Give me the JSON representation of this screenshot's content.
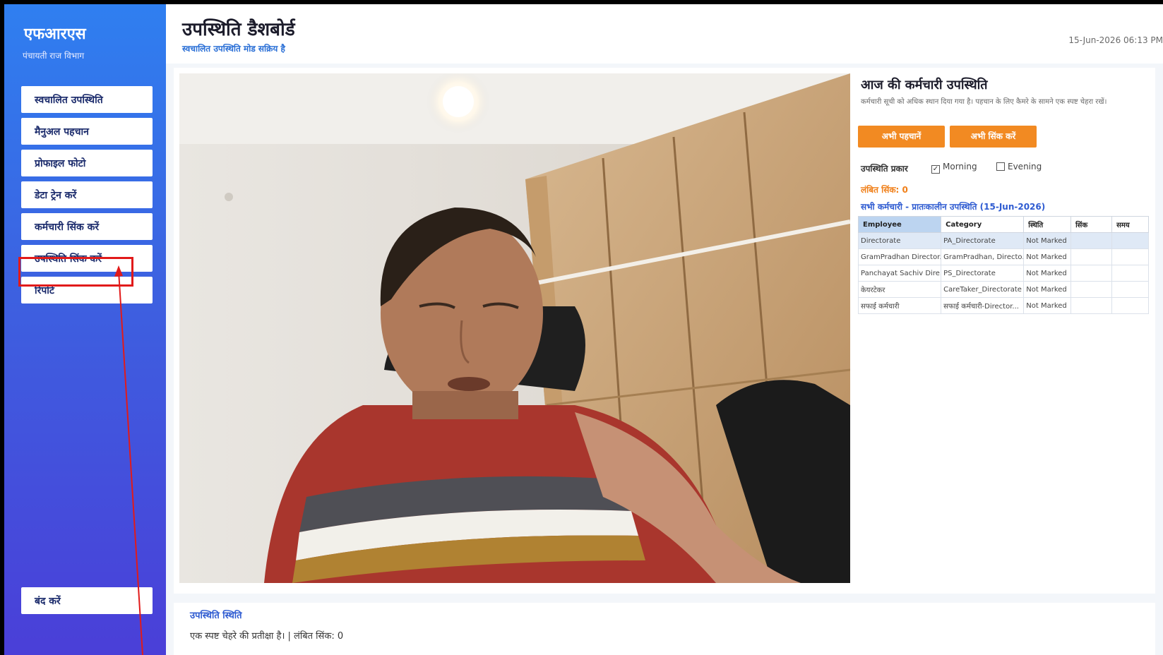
{
  "sidebar": {
    "brand": "एफआरएस",
    "brand_sub": "पंचायती राज विभाग",
    "items": [
      {
        "label": "स्वचालित उपस्थिति"
      },
      {
        "label": "मैनुअल पहचान"
      },
      {
        "label": "प्रोफाइल फोटो"
      },
      {
        "label": "डेटा ट्रेन करें"
      },
      {
        "label": "कर्मचारी सिंक करें"
      },
      {
        "label": "उपस्थिति सिंक करें"
      },
      {
        "label": "रिपोर्ट"
      }
    ],
    "close_label": "बंद करें",
    "highlight_color": "#e11a1a"
  },
  "header": {
    "title": "उपस्थिति डैशबोर्ड",
    "subtitle": "स्वचालित उपस्थिति मोड सक्रिय है",
    "datetime": "15-Jun-2026 06:13 PM"
  },
  "panel": {
    "title": "आज की कर्मचारी उपस्थिति",
    "description": "कर्मचारी सूची को अधिक स्थान दिया गया है। पहचान के लिए कैमरे के सामने एक स्पष्ट चेहरा रखें।",
    "recognize_button": "अभी पहचानें",
    "sync_button": "अभी सिंक करें",
    "attendance_type_label": "उपस्थिति प्रकार",
    "morning_label": "Morning",
    "morning_checked": true,
    "evening_label": "Evening",
    "evening_checked": false,
    "pending_sync": "लंबित सिंक: 0",
    "all_employees_heading": "सभी कर्मचारी - प्रातःकालीन उपस्थिति",
    "all_employees_date": "(15-Jun-2026)",
    "accent_color": "#f28a22"
  },
  "table": {
    "headers": [
      "Employee",
      "Category",
      "स्थिति",
      "सिंक",
      "समय"
    ],
    "rows": [
      [
        "Directorate",
        "PA_Directorate",
        "Not Marked",
        "",
        ""
      ],
      [
        "GramPradhan Director...",
        "GramPradhan, Directo...",
        "Not Marked",
        "",
        ""
      ],
      [
        "Panchayat Sachiv Dire...",
        "PS_Directorate",
        "Not Marked",
        "",
        ""
      ],
      [
        "केयरटेकर",
        "CareTaker_Directorate",
        "Not Marked",
        "",
        ""
      ],
      [
        "सफाई कर्मचारी",
        "सफाई कर्मचारी-Director...",
        "Not Marked",
        "",
        ""
      ]
    ]
  },
  "status": {
    "title": "उपस्थिति स्थिति",
    "text": "एक स्पष्ट चेहरे की प्रतीक्षा है। | लंबित सिंक: 0"
  }
}
